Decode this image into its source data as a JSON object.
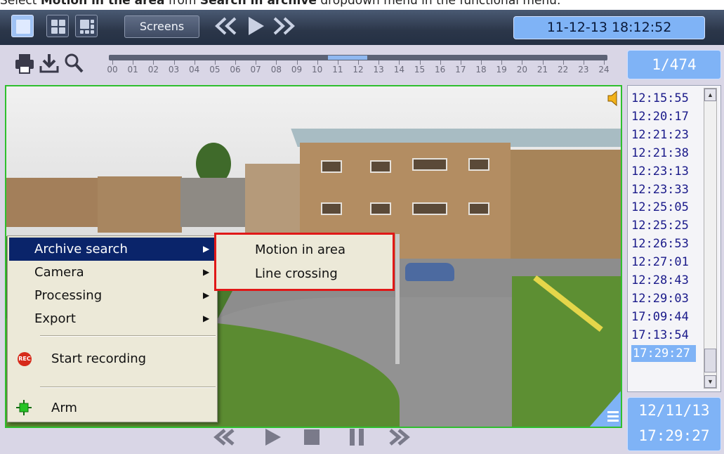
{
  "caption": {
    "prefix": "Select ",
    "bold1": "Motion in the area",
    "middle": " from ",
    "bold2": "Search in archive",
    "suffix": " dropdown menu in the functional menu."
  },
  "topbar": {
    "screens_label": "Screens",
    "datetime": "11-12-13  18:12:52",
    "rewind_icon": "double-chevron-left",
    "play_icon": "play",
    "forward_icon": "double-chevron-right"
  },
  "timeline": {
    "hours": [
      "00",
      "01",
      "02",
      "03",
      "04",
      "05",
      "06",
      "07",
      "08",
      "09",
      "10",
      "11",
      "12",
      "13",
      "14",
      "15",
      "16",
      "17",
      "18",
      "19",
      "20",
      "21",
      "22",
      "23",
      "24"
    ],
    "counter": "1/474"
  },
  "context_menu": {
    "items": [
      {
        "label": "Archive search",
        "has_submenu": true,
        "highlighted": true
      },
      {
        "label": "Camera",
        "has_submenu": true,
        "highlighted": false
      },
      {
        "label": "Processing",
        "has_submenu": true,
        "highlighted": false
      },
      {
        "label": "Export",
        "has_submenu": true,
        "highlighted": false
      }
    ],
    "start_recording": "Start recording",
    "rec_badge": "REC",
    "arm": "Arm"
  },
  "submenu": {
    "items": [
      "Motion in area",
      "Line crossing"
    ],
    "highlight_color": "#e01818"
  },
  "timestamps": {
    "items": [
      "12:15:55",
      "12:20:17",
      "12:21:23",
      "12:21:38",
      "12:23:13",
      "12:23:33",
      "12:25:05",
      "12:25:25",
      "12:26:53",
      "12:27:01",
      "12:28:43",
      "12:29:03",
      "17:09:44",
      "17:13:54",
      "17:29:27"
    ],
    "selected_index": 14
  },
  "clock": {
    "date": "12/11/13",
    "time": "17:29:27"
  },
  "colors": {
    "accent": "#7fb3f6",
    "video_border": "#2fbf2f",
    "menu_highlight": "#0a246a"
  }
}
